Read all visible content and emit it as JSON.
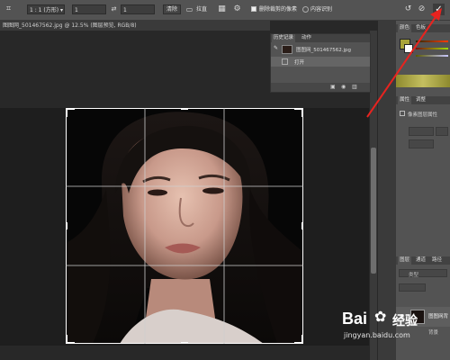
{
  "options_bar": {
    "ratio": "1 : 1 (方形)",
    "width_value": "1",
    "height_value": "1",
    "clear_button": "清除",
    "straighten_label": "拉直",
    "delete_cropped_label": "删除裁剪的像素",
    "content_aware_label": "内容识别"
  },
  "document": {
    "tab_title": "图图网_501467562.jpg @ 12.5% (图层预览, RGB/8)"
  },
  "history_panel": {
    "tab_history": "历史记录",
    "tab_other": "动作",
    "snapshot_name": "图图网_501467562.jpg",
    "open_step": "打开"
  },
  "right_panels": {
    "color_tab": "颜色",
    "swatch_tab": "色板",
    "props_tab": "属性",
    "adjust_tab": "调整",
    "props_item": "像素图层属性",
    "layers_tab": "图层",
    "channels_tab": "通道",
    "paths_tab": "路径",
    "kind_label": "类型",
    "layer_name": "图图网背",
    "layer_sub": "背景"
  },
  "watermark": {
    "brand": "Bai",
    "brand_cn": "经验",
    "url": "jingyan.baidu.com"
  },
  "colors": {
    "commit_arrow": "#e8231f",
    "olive": "#a9a43a"
  }
}
